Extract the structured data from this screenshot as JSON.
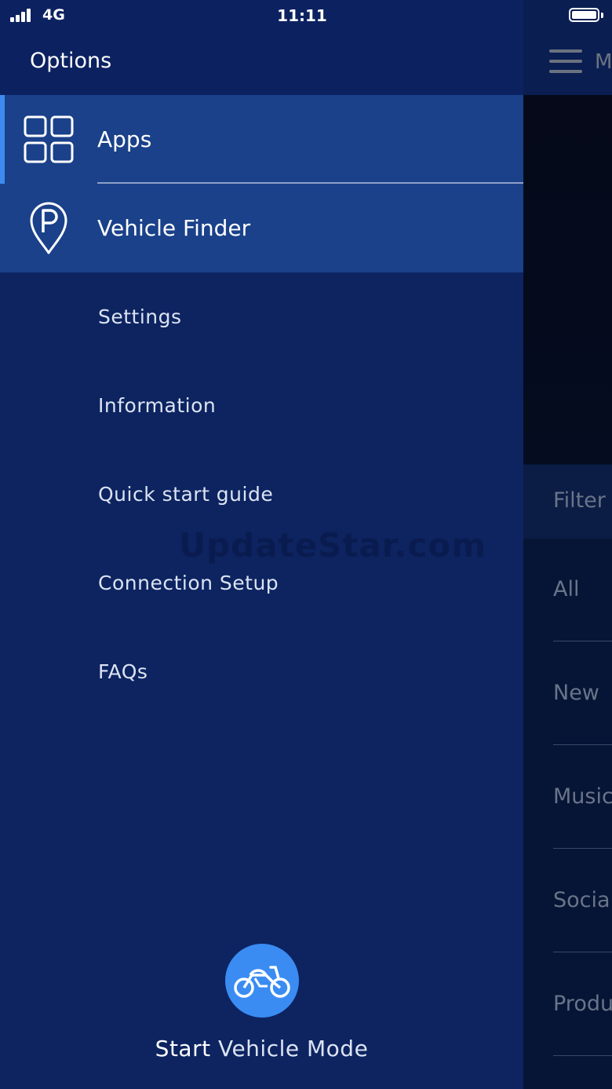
{
  "status_bar": {
    "carrier": "4G",
    "time": "11:11"
  },
  "background_screen": {
    "title_partial": "M",
    "filter_label": "Filter",
    "categories": [
      "All",
      "New",
      "Music",
      "Socia",
      "Produ"
    ]
  },
  "drawer": {
    "title": "Options",
    "primary_items": [
      {
        "label": "Apps",
        "icon": "grid-icon",
        "selected": true
      },
      {
        "label": "Vehicle Finder",
        "icon": "parking-pin-icon"
      }
    ],
    "secondary_items": [
      {
        "label": "Settings"
      },
      {
        "label": "Information"
      },
      {
        "label": "Quick start guide"
      },
      {
        "label": "Connection Setup"
      },
      {
        "label": "FAQs"
      }
    ],
    "start_button": {
      "icon": "motorcycle-icon",
      "label_strong": "Start",
      "label_rest": " Vehicle Mode"
    }
  },
  "watermark": "UpdateStar.com",
  "colors": {
    "drawer_bg": "#0d2461",
    "highlight": "#1a418a",
    "accent": "#3d8bf0",
    "button": "#3a8cf2"
  }
}
